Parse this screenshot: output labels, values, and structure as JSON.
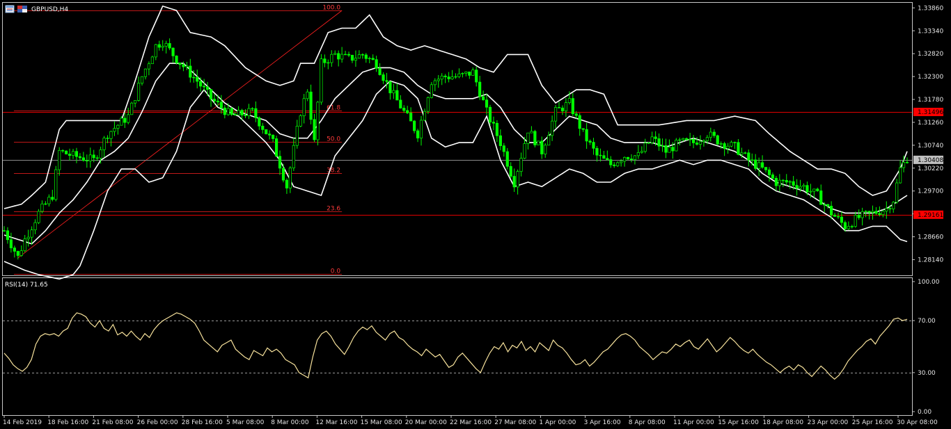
{
  "window": {
    "symbol_label": "GBPUSD,H4",
    "rsi_label": "RSI(14) 71.65"
  },
  "icons": [
    "chart-window-icon",
    "symbol-icon"
  ],
  "colors": {
    "background": "#000000",
    "candle": "#00ff00",
    "band": "#ffffff",
    "fib": "#ff2020",
    "hline": "#e00000",
    "rsi": "#f7e29c",
    "axis": "#c8c8c8",
    "price_tag_red": "#ff0000",
    "price_tag_current": "#c0c0c0"
  },
  "chart_data": [
    {
      "type": "candlestick",
      "indicators": [
        "Bollinger Bands"
      ],
      "ylim": [
        1.278,
        1.3396
      ],
      "y_ticks": [
        "1.33860",
        "1.33340",
        "1.32820",
        "1.32300",
        "1.31780",
        "1.31260",
        "1.30740",
        "1.30220",
        "1.29700",
        "1.29180",
        "1.28660",
        "1.28140"
      ],
      "x_ticks": [
        "14 Feb 2019",
        "18 Feb 16:00",
        "21 Feb 08:00",
        "26 Feb 00:00",
        "28 Feb 16:00",
        "5 Mar 08:00",
        "8 Mar 00:00",
        "12 Mar 16:00",
        "15 Mar 08:00",
        "20 Mar 00:00",
        "22 Mar 16:00",
        "27 Mar 08:00",
        "1 Apr 00:00",
        "3 Apr 16:00",
        "8 Apr 08:00",
        "11 Apr 00:00",
        "15 Apr 16:00",
        "18 Apr 08:00",
        "23 Apr 00:00",
        "25 Apr 16:00",
        "30 Apr 08:00"
      ],
      "close_path": [
        [
          0,
          1.288
        ],
        [
          4,
          1.282
        ],
        [
          6,
          1.286
        ],
        [
          10,
          1.292
        ],
        [
          14,
          1.296
        ],
        [
          16,
          1.306
        ],
        [
          20,
          1.305
        ],
        [
          26,
          1.304
        ],
        [
          30,
          1.31
        ],
        [
          36,
          1.314
        ],
        [
          40,
          1.323
        ],
        [
          44,
          1.33
        ],
        [
          46,
          1.331
        ],
        [
          50,
          1.327
        ],
        [
          56,
          1.322
        ],
        [
          60,
          1.318
        ],
        [
          66,
          1.314
        ],
        [
          72,
          1.315
        ],
        [
          78,
          1.308
        ],
        [
          82,
          1.298
        ],
        [
          86,
          1.315
        ],
        [
          88,
          1.32
        ],
        [
          90,
          1.308
        ],
        [
          92,
          1.326
        ],
        [
          96,
          1.328
        ],
        [
          100,
          1.327
        ],
        [
          104,
          1.328
        ],
        [
          108,
          1.326
        ],
        [
          112,
          1.32
        ],
        [
          116,
          1.315
        ],
        [
          120,
          1.31
        ],
        [
          124,
          1.322
        ],
        [
          128,
          1.323
        ],
        [
          132,
          1.323
        ],
        [
          136,
          1.324
        ],
        [
          140,
          1.315
        ],
        [
          144,
          1.308
        ],
        [
          148,
          1.299
        ],
        [
          152,
          1.311
        ],
        [
          156,
          1.306
        ],
        [
          160,
          1.315
        ],
        [
          164,
          1.317
        ],
        [
          168,
          1.31
        ],
        [
          172,
          1.305
        ],
        [
          176,
          1.303
        ],
        [
          180,
          1.305
        ],
        [
          184,
          1.305
        ],
        [
          188,
          1.309
        ],
        [
          192,
          1.306
        ],
        [
          196,
          1.308
        ],
        [
          200,
          1.308
        ],
        [
          204,
          1.31
        ],
        [
          208,
          1.308
        ],
        [
          212,
          1.307
        ],
        [
          216,
          1.304
        ],
        [
          220,
          1.302
        ],
        [
          224,
          1.299
        ],
        [
          228,
          1.299
        ],
        [
          232,
          1.298
        ],
        [
          236,
          1.296
        ],
        [
          240,
          1.292
        ],
        [
          244,
          1.289
        ],
        [
          248,
          1.291
        ],
        [
          252,
          1.292
        ],
        [
          256,
          1.293
        ],
        [
          258,
          1.295
        ],
        [
          260,
          1.302
        ],
        [
          262,
          1.3045
        ]
      ],
      "x_max_bar": 262,
      "bollinger_upper": [
        [
          0,
          1.293
        ],
        [
          5,
          1.294
        ],
        [
          8,
          1.296
        ],
        [
          12,
          1.299
        ],
        [
          16,
          1.311
        ],
        [
          18,
          1.313
        ],
        [
          22,
          1.313
        ],
        [
          28,
          1.313
        ],
        [
          34,
          1.313
        ],
        [
          38,
          1.322
        ],
        [
          42,
          1.332
        ],
        [
          46,
          1.339
        ],
        [
          50,
          1.338
        ],
        [
          54,
          1.333
        ],
        [
          60,
          1.332
        ],
        [
          64,
          1.33
        ],
        [
          70,
          1.325
        ],
        [
          76,
          1.322
        ],
        [
          80,
          1.321
        ],
        [
          84,
          1.322
        ],
        [
          86,
          1.326
        ],
        [
          90,
          1.326
        ],
        [
          94,
          1.333
        ],
        [
          98,
          1.334
        ],
        [
          102,
          1.334
        ],
        [
          106,
          1.337
        ],
        [
          110,
          1.332
        ],
        [
          114,
          1.33
        ],
        [
          118,
          1.329
        ],
        [
          122,
          1.33
        ],
        [
          126,
          1.329
        ],
        [
          130,
          1.328
        ],
        [
          134,
          1.327
        ],
        [
          138,
          1.325
        ],
        [
          142,
          1.324
        ],
        [
          146,
          1.328
        ],
        [
          152,
          1.328
        ],
        [
          156,
          1.321
        ],
        [
          160,
          1.317
        ],
        [
          166,
          1.32
        ],
        [
          170,
          1.32
        ],
        [
          174,
          1.319
        ],
        [
          178,
          1.312
        ],
        [
          182,
          1.312
        ],
        [
          190,
          1.312
        ],
        [
          198,
          1.313
        ],
        [
          202,
          1.313
        ],
        [
          206,
          1.313
        ],
        [
          212,
          1.314
        ],
        [
          218,
          1.313
        ],
        [
          222,
          1.31
        ],
        [
          228,
          1.306
        ],
        [
          232,
          1.304
        ],
        [
          236,
          1.302
        ],
        [
          240,
          1.302
        ],
        [
          244,
          1.301
        ],
        [
          248,
          1.298
        ],
        [
          252,
          1.296
        ],
        [
          256,
          1.297
        ],
        [
          260,
          1.302
        ],
        [
          262,
          1.306
        ]
      ],
      "bollinger_middle": [
        [
          0,
          1.287
        ],
        [
          4,
          1.286
        ],
        [
          8,
          1.285
        ],
        [
          12,
          1.288
        ],
        [
          16,
          1.292
        ],
        [
          20,
          1.295
        ],
        [
          24,
          1.299
        ],
        [
          28,
          1.304
        ],
        [
          32,
          1.306
        ],
        [
          36,
          1.309
        ],
        [
          40,
          1.315
        ],
        [
          44,
          1.322
        ],
        [
          48,
          1.326
        ],
        [
          52,
          1.326
        ],
        [
          56,
          1.323
        ],
        [
          60,
          1.32
        ],
        [
          64,
          1.317
        ],
        [
          68,
          1.315
        ],
        [
          72,
          1.314
        ],
        [
          76,
          1.313
        ],
        [
          80,
          1.31
        ],
        [
          84,
          1.309
        ],
        [
          88,
          1.309
        ],
        [
          92,
          1.313
        ],
        [
          96,
          1.318
        ],
        [
          100,
          1.321
        ],
        [
          104,
          1.324
        ],
        [
          108,
          1.325
        ],
        [
          112,
          1.325
        ],
        [
          116,
          1.324
        ],
        [
          120,
          1.321
        ],
        [
          124,
          1.319
        ],
        [
          128,
          1.318
        ],
        [
          132,
          1.318
        ],
        [
          136,
          1.318
        ],
        [
          140,
          1.319
        ],
        [
          144,
          1.316
        ],
        [
          148,
          1.311
        ],
        [
          152,
          1.308
        ],
        [
          156,
          1.308
        ],
        [
          160,
          1.311
        ],
        [
          164,
          1.314
        ],
        [
          168,
          1.313
        ],
        [
          172,
          1.312
        ],
        [
          176,
          1.309
        ],
        [
          180,
          1.308
        ],
        [
          184,
          1.308
        ],
        [
          188,
          1.308
        ],
        [
          192,
          1.307
        ],
        [
          196,
          1.308
        ],
        [
          200,
          1.309
        ],
        [
          204,
          1.308
        ],
        [
          208,
          1.307
        ],
        [
          212,
          1.306
        ],
        [
          216,
          1.304
        ],
        [
          220,
          1.301
        ],
        [
          224,
          1.299
        ],
        [
          228,
          1.298
        ],
        [
          232,
          1.297
        ],
        [
          236,
          1.295
        ],
        [
          240,
          1.293
        ],
        [
          244,
          1.292
        ],
        [
          248,
          1.292
        ],
        [
          252,
          1.292
        ],
        [
          256,
          1.293
        ],
        [
          260,
          1.295
        ],
        [
          262,
          1.296
        ]
      ],
      "bollinger_lower": [
        [
          0,
          1.281
        ],
        [
          6,
          1.279
        ],
        [
          10,
          1.278
        ],
        [
          16,
          1.277
        ],
        [
          20,
          1.278
        ],
        [
          22,
          1.28
        ],
        [
          26,
          1.288
        ],
        [
          30,
          1.297
        ],
        [
          34,
          1.302
        ],
        [
          38,
          1.302
        ],
        [
          42,
          1.299
        ],
        [
          46,
          1.3
        ],
        [
          50,
          1.306
        ],
        [
          54,
          1.316
        ],
        [
          58,
          1.32
        ],
        [
          62,
          1.316
        ],
        [
          68,
          1.314
        ],
        [
          72,
          1.311
        ],
        [
          76,
          1.308
        ],
        [
          80,
          1.304
        ],
        [
          84,
          1.298
        ],
        [
          88,
          1.297
        ],
        [
          92,
          1.296
        ],
        [
          96,
          1.305
        ],
        [
          100,
          1.309
        ],
        [
          104,
          1.313
        ],
        [
          108,
          1.319
        ],
        [
          112,
          1.322
        ],
        [
          116,
          1.321
        ],
        [
          120,
          1.318
        ],
        [
          124,
          1.309
        ],
        [
          128,
          1.307
        ],
        [
          132,
          1.308
        ],
        [
          136,
          1.308
        ],
        [
          140,
          1.314
        ],
        [
          144,
          1.304
        ],
        [
          148,
          1.298
        ],
        [
          152,
          1.299
        ],
        [
          156,
          1.298
        ],
        [
          160,
          1.3
        ],
        [
          164,
          1.302
        ],
        [
          168,
          1.301
        ],
        [
          172,
          1.299
        ],
        [
          176,
          1.299
        ],
        [
          180,
          1.301
        ],
        [
          184,
          1.302
        ],
        [
          188,
          1.302
        ],
        [
          192,
          1.303
        ],
        [
          196,
          1.304
        ],
        [
          200,
          1.303
        ],
        [
          204,
          1.304
        ],
        [
          208,
          1.304
        ],
        [
          212,
          1.303
        ],
        [
          216,
          1.302
        ],
        [
          220,
          1.299
        ],
        [
          224,
          1.297
        ],
        [
          228,
          1.296
        ],
        [
          232,
          1.295
        ],
        [
          236,
          1.293
        ],
        [
          240,
          1.291
        ],
        [
          244,
          1.288
        ],
        [
          248,
          1.288
        ],
        [
          252,
          1.289
        ],
        [
          256,
          1.289
        ],
        [
          260,
          1.286
        ],
        [
          262,
          1.2855
        ]
      ],
      "fibonacci": {
        "anchor_start": [
          4,
          1.2818
        ],
        "anchor_end": [
          98,
          1.338
        ],
        "x_end": 98,
        "levels": [
          {
            "label": "100.0",
            "price": 1.338
          },
          {
            "label": "61.8",
            "price": 1.3153
          },
          {
            "label": "50.0",
            "price": 1.3081
          },
          {
            "label": "38.2",
            "price": 1.301
          },
          {
            "label": "23.6",
            "price": 1.2923
          },
          {
            "label": "0.0",
            "price": 1.2782
          }
        ]
      },
      "horizontal_lines": [
        {
          "price": 1.31496,
          "label": "1.31496",
          "tag": "red"
        },
        {
          "price": 1.29161,
          "label": "1.29161",
          "tag": "red"
        },
        {
          "price": 1.30408,
          "label": "1.30408",
          "tag": "current"
        }
      ]
    },
    {
      "type": "line",
      "title": "RSI(14) 71.65",
      "ylim": [
        0,
        100
      ],
      "y_ticks": [
        "100.00",
        "70.00",
        "30.00",
        "0.00"
      ],
      "levels": [
        70,
        30
      ],
      "series": [
        {
          "values": [
            45,
            41,
            36,
            33,
            31,
            34,
            40,
            52,
            58,
            60,
            59,
            60,
            58,
            62,
            64,
            72,
            76,
            75,
            73,
            68,
            65,
            70,
            64,
            62,
            67,
            59,
            61,
            58,
            62,
            58,
            55,
            60,
            57,
            63,
            67,
            70,
            72,
            74,
            76,
            75,
            73,
            71,
            68,
            62,
            55,
            52,
            49,
            46,
            51,
            53,
            55,
            48,
            45,
            42,
            40,
            47,
            45,
            43,
            49,
            46,
            48,
            45,
            40,
            38,
            36,
            30,
            28,
            26,
            42,
            55,
            60,
            62,
            58,
            52,
            48,
            44,
            50,
            57,
            62,
            65,
            63,
            66,
            61,
            58,
            55,
            60,
            62,
            57,
            55,
            51,
            48,
            46,
            43,
            48,
            45,
            42,
            44,
            39,
            34,
            36,
            42,
            45,
            41,
            37,
            33,
            30,
            38,
            45,
            50,
            48,
            53,
            46,
            51,
            49,
            54,
            47,
            50,
            46,
            53,
            50,
            47,
            55,
            51,
            49,
            45,
            40,
            36,
            37,
            40,
            35,
            38,
            42,
            46,
            48,
            52,
            56,
            59,
            60,
            58,
            55,
            50,
            47,
            44,
            40,
            43,
            46,
            45,
            48,
            52,
            50,
            53,
            55,
            50,
            48,
            52,
            56,
            51,
            46,
            49,
            53,
            57,
            54,
            50,
            47,
            45,
            48,
            44,
            41,
            38,
            36,
            33,
            30,
            33,
            35,
            32,
            36,
            34,
            30,
            27,
            31,
            35,
            32,
            28,
            25,
            28,
            33,
            39,
            43,
            47,
            50,
            54,
            56,
            52,
            58,
            62,
            66,
            71,
            72,
            70,
            71
          ]
        }
      ],
      "x_ticks_shared": true
    }
  ]
}
